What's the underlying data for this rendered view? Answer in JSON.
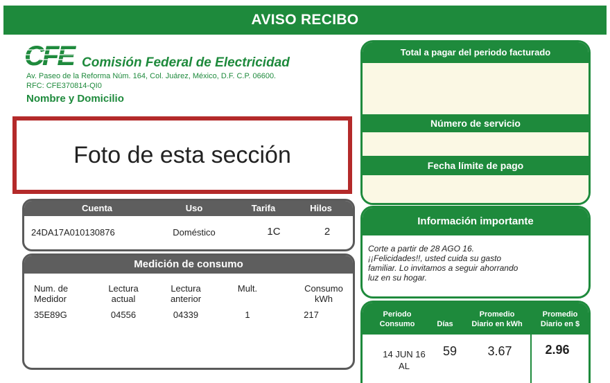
{
  "header": {
    "title": "AVISO RECIBO"
  },
  "company": {
    "logo_text": "CFE",
    "name": "Comisión Federal de Electricidad",
    "address": "Av. Paseo de la Reforma Núm. 164, Col. Juárez, México, D.F. C.P. 06600.",
    "rfc": "RFC: CFE370814-QI0",
    "section_label": "Nombre y Domicilio"
  },
  "photo_placeholder": "Foto de esta sección",
  "account": {
    "headers": [
      "Cuenta",
      "Uso",
      "Tarifa",
      "Hilos"
    ],
    "values": [
      "24DA17A010130876",
      "Doméstico",
      "1C",
      "2"
    ]
  },
  "consumption": {
    "title": "Medición de consumo",
    "headers": [
      {
        "line1": "Num. de",
        "line2": "Medidor"
      },
      {
        "line1": "Lectura",
        "line2": "actual"
      },
      {
        "line1": "Lectura",
        "line2": "anterior"
      },
      {
        "line1": "Mult.",
        "line2": ""
      },
      {
        "line1": "Consumo",
        "line2": "kWh"
      }
    ],
    "values": [
      "35E89G",
      "04556",
      "04339",
      "1",
      "217"
    ]
  },
  "payment": {
    "total_label": "Total a pagar del periodo facturado",
    "service_label": "Número de servicio",
    "due_label": "Fecha límite de pago"
  },
  "info": {
    "title": "Información importante",
    "lines": [
      "Corte a partir de 28 AGO 16.",
      "¡¡Felicidades!!, usted cuida su gasto",
      "familiar. Lo invitamos a seguir ahorrando",
      "luz en su hogar."
    ]
  },
  "period": {
    "headers": [
      {
        "line1": "Periodo",
        "line2": "Consumo"
      },
      {
        "line1": "Días",
        "line2": ""
      },
      {
        "line1": "Promedio",
        "line2": "Diario en kWh"
      },
      {
        "line1": "Promedio",
        "line2": "Diario en $"
      }
    ],
    "values": {
      "period_line1": "14 JUN 16",
      "period_line2": "AL",
      "days": "59",
      "avg_kwh": "3.67",
      "avg_money": "2.96"
    }
  },
  "colors": {
    "brand_green": "#1e8a3c",
    "dark_gray": "#5e5e5e",
    "photo_border": "#b42a2a",
    "cream": "#fbf8e4"
  }
}
